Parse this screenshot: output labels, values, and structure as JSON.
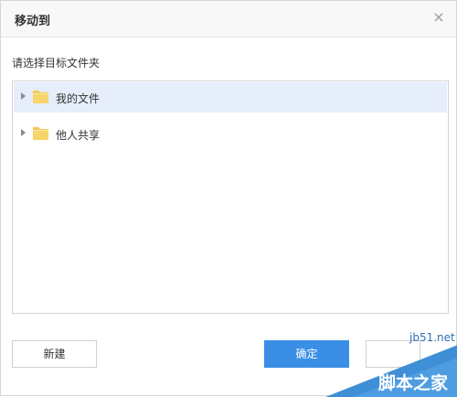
{
  "dialog": {
    "title": "移动到",
    "close_glyph": "×",
    "prompt": "请选择目标文件夹"
  },
  "tree": {
    "items": [
      {
        "label": "我的文件",
        "icon": "folder-icon",
        "selected": true
      },
      {
        "label": "他人共享",
        "icon": "folder-icon",
        "selected": false
      }
    ]
  },
  "buttons": {
    "new_label": "新建",
    "ok_label": "确定",
    "cancel_label": ""
  },
  "watermark": {
    "site": "jb51.net",
    "name": "脚本之家"
  },
  "colors": {
    "accent": "#3a8ee6",
    "selected_row": "#e5eefa",
    "folder": "#f8d56b"
  }
}
